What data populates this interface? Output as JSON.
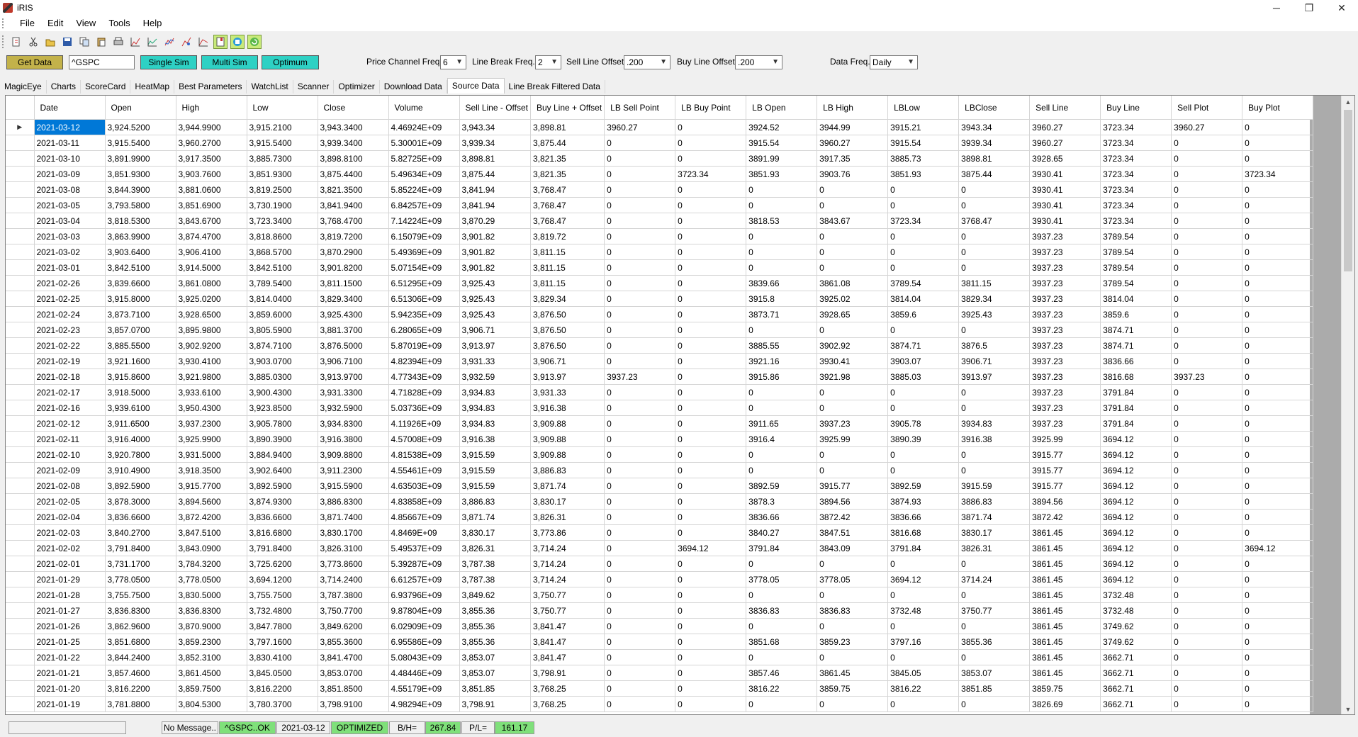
{
  "window": {
    "title": "iRIS",
    "min_glyph": "─",
    "max_glyph": "❐",
    "close_glyph": "✕"
  },
  "menu": [
    "File",
    "Edit",
    "View",
    "Tools",
    "Help"
  ],
  "toolbar": {
    "icons": [
      "new-icon",
      "cut-icon",
      "open-icon",
      "save-icon",
      "copy-icon",
      "paste-icon",
      "print-icon",
      "chart-icon",
      "chart-line-icon",
      "chart-multi-icon",
      "chart-alt-icon",
      "chart-compare-icon",
      "bookmark-icon",
      "stop-icon",
      "refresh-icon"
    ]
  },
  "controls": {
    "get_data": "Get Data",
    "symbol": "^GSPC",
    "single_sim": "Single Sim",
    "multi_sim": "Multi Sim",
    "optimum": "Optimum",
    "price_channel_label": "Price Channel Freq.",
    "price_channel_value": "6",
    "line_break_label": "Line Break Freq.",
    "line_break_value": "2",
    "sell_offset_label": "Sell Line Offset",
    "sell_offset_value": ".200",
    "buy_offset_label": "Buy Line Offset",
    "buy_offset_value": ".200",
    "data_freq_label": "Data Freq.",
    "data_freq_value": "Daily"
  },
  "tabs": [
    "MagicEye",
    "Charts",
    "ScoreCard",
    "HeatMap",
    "Best Parameters",
    "WatchList",
    "Scanner",
    "Optimizer",
    "Download Data",
    "Source Data",
    "Line Break Filtered Data"
  ],
  "selected_tab": "Source Data",
  "table": {
    "columns": [
      "Date",
      "Open",
      "High",
      "Low",
      "Close",
      "Volume",
      "Sell Line - Offset",
      "Buy Line + Offset",
      "LB Sell Point",
      "LB Buy Point",
      "LB Open",
      "LB High",
      "LBLow",
      "LBClose",
      "Sell Line",
      "Buy Line",
      "Sell Plot",
      "Buy Plot"
    ],
    "selected_row_marker": "▶",
    "rows": [
      [
        "2021-03-12",
        "3,924.5200",
        "3,944.9900",
        "3,915.2100",
        "3,943.3400",
        "4.46924E+09",
        "3,943.34",
        "3,898.81",
        "3960.27",
        "0",
        "3924.52",
        "3944.99",
        "3915.21",
        "3943.34",
        "3960.27",
        "3723.34",
        "3960.27",
        "0"
      ],
      [
        "2021-03-11",
        "3,915.5400",
        "3,960.2700",
        "3,915.5400",
        "3,939.3400",
        "5.30001E+09",
        "3,939.34",
        "3,875.44",
        "0",
        "0",
        "3915.54",
        "3960.27",
        "3915.54",
        "3939.34",
        "3960.27",
        "3723.34",
        "0",
        "0"
      ],
      [
        "2021-03-10",
        "3,891.9900",
        "3,917.3500",
        "3,885.7300",
        "3,898.8100",
        "5.82725E+09",
        "3,898.81",
        "3,821.35",
        "0",
        "0",
        "3891.99",
        "3917.35",
        "3885.73",
        "3898.81",
        "3928.65",
        "3723.34",
        "0",
        "0"
      ],
      [
        "2021-03-09",
        "3,851.9300",
        "3,903.7600",
        "3,851.9300",
        "3,875.4400",
        "5.49634E+09",
        "3,875.44",
        "3,821.35",
        "0",
        "3723.34",
        "3851.93",
        "3903.76",
        "3851.93",
        "3875.44",
        "3930.41",
        "3723.34",
        "0",
        "3723.34"
      ],
      [
        "2021-03-08",
        "3,844.3900",
        "3,881.0600",
        "3,819.2500",
        "3,821.3500",
        "5.85224E+09",
        "3,841.94",
        "3,768.47",
        "0",
        "0",
        "0",
        "0",
        "0",
        "0",
        "3930.41",
        "3723.34",
        "0",
        "0"
      ],
      [
        "2021-03-05",
        "3,793.5800",
        "3,851.6900",
        "3,730.1900",
        "3,841.9400",
        "6.84257E+09",
        "3,841.94",
        "3,768.47",
        "0",
        "0",
        "0",
        "0",
        "0",
        "0",
        "3930.41",
        "3723.34",
        "0",
        "0"
      ],
      [
        "2021-03-04",
        "3,818.5300",
        "3,843.6700",
        "3,723.3400",
        "3,768.4700",
        "7.14224E+09",
        "3,870.29",
        "3,768.47",
        "0",
        "0",
        "3818.53",
        "3843.67",
        "3723.34",
        "3768.47",
        "3930.41",
        "3723.34",
        "0",
        "0"
      ],
      [
        "2021-03-03",
        "3,863.9900",
        "3,874.4700",
        "3,818.8600",
        "3,819.7200",
        "6.15079E+09",
        "3,901.82",
        "3,819.72",
        "0",
        "0",
        "0",
        "0",
        "0",
        "0",
        "3937.23",
        "3789.54",
        "0",
        "0"
      ],
      [
        "2021-03-02",
        "3,903.6400",
        "3,906.4100",
        "3,868.5700",
        "3,870.2900",
        "5.49369E+09",
        "3,901.82",
        "3,811.15",
        "0",
        "0",
        "0",
        "0",
        "0",
        "0",
        "3937.23",
        "3789.54",
        "0",
        "0"
      ],
      [
        "2021-03-01",
        "3,842.5100",
        "3,914.5000",
        "3,842.5100",
        "3,901.8200",
        "5.07154E+09",
        "3,901.82",
        "3,811.15",
        "0",
        "0",
        "0",
        "0",
        "0",
        "0",
        "3937.23",
        "3789.54",
        "0",
        "0"
      ],
      [
        "2021-02-26",
        "3,839.6600",
        "3,861.0800",
        "3,789.5400",
        "3,811.1500",
        "6.51295E+09",
        "3,925.43",
        "3,811.15",
        "0",
        "0",
        "3839.66",
        "3861.08",
        "3789.54",
        "3811.15",
        "3937.23",
        "3789.54",
        "0",
        "0"
      ],
      [
        "2021-02-25",
        "3,915.8000",
        "3,925.0200",
        "3,814.0400",
        "3,829.3400",
        "6.51306E+09",
        "3,925.43",
        "3,829.34",
        "0",
        "0",
        "3915.8",
        "3925.02",
        "3814.04",
        "3829.34",
        "3937.23",
        "3814.04",
        "0",
        "0"
      ],
      [
        "2021-02-24",
        "3,873.7100",
        "3,928.6500",
        "3,859.6000",
        "3,925.4300",
        "5.94235E+09",
        "3,925.43",
        "3,876.50",
        "0",
        "0",
        "3873.71",
        "3928.65",
        "3859.6",
        "3925.43",
        "3937.23",
        "3859.6",
        "0",
        "0"
      ],
      [
        "2021-02-23",
        "3,857.0700",
        "3,895.9800",
        "3,805.5900",
        "3,881.3700",
        "6.28065E+09",
        "3,906.71",
        "3,876.50",
        "0",
        "0",
        "0",
        "0",
        "0",
        "0",
        "3937.23",
        "3874.71",
        "0",
        "0"
      ],
      [
        "2021-02-22",
        "3,885.5500",
        "3,902.9200",
        "3,874.7100",
        "3,876.5000",
        "5.87019E+09",
        "3,913.97",
        "3,876.50",
        "0",
        "0",
        "3885.55",
        "3902.92",
        "3874.71",
        "3876.5",
        "3937.23",
        "3874.71",
        "0",
        "0"
      ],
      [
        "2021-02-19",
        "3,921.1600",
        "3,930.4100",
        "3,903.0700",
        "3,906.7100",
        "4.82394E+09",
        "3,931.33",
        "3,906.71",
        "0",
        "0",
        "3921.16",
        "3930.41",
        "3903.07",
        "3906.71",
        "3937.23",
        "3836.66",
        "0",
        "0"
      ],
      [
        "2021-02-18",
        "3,915.8600",
        "3,921.9800",
        "3,885.0300",
        "3,913.9700",
        "4.77343E+09",
        "3,932.59",
        "3,913.97",
        "3937.23",
        "0",
        "3915.86",
        "3921.98",
        "3885.03",
        "3913.97",
        "3937.23",
        "3816.68",
        "3937.23",
        "0"
      ],
      [
        "2021-02-17",
        "3,918.5000",
        "3,933.6100",
        "3,900.4300",
        "3,931.3300",
        "4.71828E+09",
        "3,934.83",
        "3,931.33",
        "0",
        "0",
        "0",
        "0",
        "0",
        "0",
        "3937.23",
        "3791.84",
        "0",
        "0"
      ],
      [
        "2021-02-16",
        "3,939.6100",
        "3,950.4300",
        "3,923.8500",
        "3,932.5900",
        "5.03736E+09",
        "3,934.83",
        "3,916.38",
        "0",
        "0",
        "0",
        "0",
        "0",
        "0",
        "3937.23",
        "3791.84",
        "0",
        "0"
      ],
      [
        "2021-02-12",
        "3,911.6500",
        "3,937.2300",
        "3,905.7800",
        "3,934.8300",
        "4.11926E+09",
        "3,934.83",
        "3,909.88",
        "0",
        "0",
        "3911.65",
        "3937.23",
        "3905.78",
        "3934.83",
        "3937.23",
        "3791.84",
        "0",
        "0"
      ],
      [
        "2021-02-11",
        "3,916.4000",
        "3,925.9900",
        "3,890.3900",
        "3,916.3800",
        "4.57008E+09",
        "3,916.38",
        "3,909.88",
        "0",
        "0",
        "3916.4",
        "3925.99",
        "3890.39",
        "3916.38",
        "3925.99",
        "3694.12",
        "0",
        "0"
      ],
      [
        "2021-02-10",
        "3,920.7800",
        "3,931.5000",
        "3,884.9400",
        "3,909.8800",
        "4.81538E+09",
        "3,915.59",
        "3,909.88",
        "0",
        "0",
        "0",
        "0",
        "0",
        "0",
        "3915.77",
        "3694.12",
        "0",
        "0"
      ],
      [
        "2021-02-09",
        "3,910.4900",
        "3,918.3500",
        "3,902.6400",
        "3,911.2300",
        "4.55461E+09",
        "3,915.59",
        "3,886.83",
        "0",
        "0",
        "0",
        "0",
        "0",
        "0",
        "3915.77",
        "3694.12",
        "0",
        "0"
      ],
      [
        "2021-02-08",
        "3,892.5900",
        "3,915.7700",
        "3,892.5900",
        "3,915.5900",
        "4.63503E+09",
        "3,915.59",
        "3,871.74",
        "0",
        "0",
        "3892.59",
        "3915.77",
        "3892.59",
        "3915.59",
        "3915.77",
        "3694.12",
        "0",
        "0"
      ],
      [
        "2021-02-05",
        "3,878.3000",
        "3,894.5600",
        "3,874.9300",
        "3,886.8300",
        "4.83858E+09",
        "3,886.83",
        "3,830.17",
        "0",
        "0",
        "3878.3",
        "3894.56",
        "3874.93",
        "3886.83",
        "3894.56",
        "3694.12",
        "0",
        "0"
      ],
      [
        "2021-02-04",
        "3,836.6600",
        "3,872.4200",
        "3,836.6600",
        "3,871.7400",
        "4.85667E+09",
        "3,871.74",
        "3,826.31",
        "0",
        "0",
        "3836.66",
        "3872.42",
        "3836.66",
        "3871.74",
        "3872.42",
        "3694.12",
        "0",
        "0"
      ],
      [
        "2021-02-03",
        "3,840.2700",
        "3,847.5100",
        "3,816.6800",
        "3,830.1700",
        "4.8469E+09",
        "3,830.17",
        "3,773.86",
        "0",
        "0",
        "3840.27",
        "3847.51",
        "3816.68",
        "3830.17",
        "3861.45",
        "3694.12",
        "0",
        "0"
      ],
      [
        "2021-02-02",
        "3,791.8400",
        "3,843.0900",
        "3,791.8400",
        "3,826.3100",
        "5.49537E+09",
        "3,826.31",
        "3,714.24",
        "0",
        "3694.12",
        "3791.84",
        "3843.09",
        "3791.84",
        "3826.31",
        "3861.45",
        "3694.12",
        "0",
        "3694.12"
      ],
      [
        "2021-02-01",
        "3,731.1700",
        "3,784.3200",
        "3,725.6200",
        "3,773.8600",
        "5.39287E+09",
        "3,787.38",
        "3,714.24",
        "0",
        "0",
        "0",
        "0",
        "0",
        "0",
        "3861.45",
        "3694.12",
        "0",
        "0"
      ],
      [
        "2021-01-29",
        "3,778.0500",
        "3,778.0500",
        "3,694.1200",
        "3,714.2400",
        "6.61257E+09",
        "3,787.38",
        "3,714.24",
        "0",
        "0",
        "3778.05",
        "3778.05",
        "3694.12",
        "3714.24",
        "3861.45",
        "3694.12",
        "0",
        "0"
      ],
      [
        "2021-01-28",
        "3,755.7500",
        "3,830.5000",
        "3,755.7500",
        "3,787.3800",
        "6.93796E+09",
        "3,849.62",
        "3,750.77",
        "0",
        "0",
        "0",
        "0",
        "0",
        "0",
        "3861.45",
        "3732.48",
        "0",
        "0"
      ],
      [
        "2021-01-27",
        "3,836.8300",
        "3,836.8300",
        "3,732.4800",
        "3,750.7700",
        "9.87804E+09",
        "3,855.36",
        "3,750.77",
        "0",
        "0",
        "3836.83",
        "3836.83",
        "3732.48",
        "3750.77",
        "3861.45",
        "3732.48",
        "0",
        "0"
      ],
      [
        "2021-01-26",
        "3,862.9600",
        "3,870.9000",
        "3,847.7800",
        "3,849.6200",
        "6.02909E+09",
        "3,855.36",
        "3,841.47",
        "0",
        "0",
        "0",
        "0",
        "0",
        "0",
        "3861.45",
        "3749.62",
        "0",
        "0"
      ],
      [
        "2021-01-25",
        "3,851.6800",
        "3,859.2300",
        "3,797.1600",
        "3,855.3600",
        "6.95586E+09",
        "3,855.36",
        "3,841.47",
        "0",
        "0",
        "3851.68",
        "3859.23",
        "3797.16",
        "3855.36",
        "3861.45",
        "3749.62",
        "0",
        "0"
      ],
      [
        "2021-01-22",
        "3,844.2400",
        "3,852.3100",
        "3,830.4100",
        "3,841.4700",
        "5.08043E+09",
        "3,853.07",
        "3,841.47",
        "0",
        "0",
        "0",
        "0",
        "0",
        "0",
        "3861.45",
        "3662.71",
        "0",
        "0"
      ],
      [
        "2021-01-21",
        "3,857.4600",
        "3,861.4500",
        "3,845.0500",
        "3,853.0700",
        "4.48446E+09",
        "3,853.07",
        "3,798.91",
        "0",
        "0",
        "3857.46",
        "3861.45",
        "3845.05",
        "3853.07",
        "3861.45",
        "3662.71",
        "0",
        "0"
      ],
      [
        "2021-01-20",
        "3,816.2200",
        "3,859.7500",
        "3,816.2200",
        "3,851.8500",
        "4.55179E+09",
        "3,851.85",
        "3,768.25",
        "0",
        "0",
        "3816.22",
        "3859.75",
        "3816.22",
        "3851.85",
        "3859.75",
        "3662.71",
        "0",
        "0"
      ],
      [
        "2021-01-19",
        "3,781.8800",
        "3,804.5300",
        "3,780.3700",
        "3,798.9100",
        "4.98294E+09",
        "3,798.91",
        "3,768.25",
        "0",
        "0",
        "0",
        "0",
        "0",
        "0",
        "3826.69",
        "3662.71",
        "0",
        "0"
      ]
    ]
  },
  "status": {
    "message": "No Message..",
    "symbol_status": "^GSPC..OK",
    "date": "2021-03-12",
    "optimized": "OPTIMIZED",
    "bh_label": "B/H=",
    "bh_value": "267.84",
    "pl_label": "P/L=",
    "pl_value": "161.17"
  },
  "colors": {
    "get_data": "#c3b24a",
    "sim_buttons": "#2ed1c4",
    "status_green": "#7fe07a",
    "selection": "#0078d7"
  }
}
